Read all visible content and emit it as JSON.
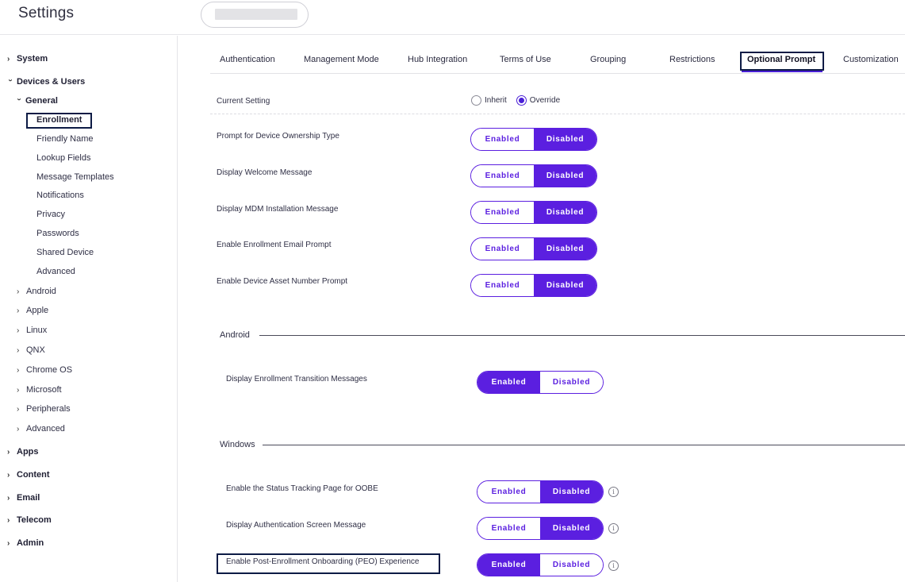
{
  "header": {
    "title": "Settings"
  },
  "sidebar": {
    "items": [
      {
        "label": "System"
      },
      {
        "label": "Devices & Users"
      },
      {
        "label": "General"
      },
      {
        "label": "Enrollment"
      },
      {
        "label": "Friendly Name"
      },
      {
        "label": "Lookup Fields"
      },
      {
        "label": "Message Templates"
      },
      {
        "label": "Notifications"
      },
      {
        "label": "Privacy"
      },
      {
        "label": "Passwords"
      },
      {
        "label": "Shared Device"
      },
      {
        "label": "Advanced"
      },
      {
        "label": "Android"
      },
      {
        "label": "Apple"
      },
      {
        "label": "Linux"
      },
      {
        "label": "QNX"
      },
      {
        "label": "Chrome OS"
      },
      {
        "label": "Microsoft"
      },
      {
        "label": "Peripherals"
      },
      {
        "label": "Advanced"
      },
      {
        "label": "Apps"
      },
      {
        "label": "Content"
      },
      {
        "label": "Email"
      },
      {
        "label": "Telecom"
      },
      {
        "label": "Admin"
      }
    ]
  },
  "tabs": [
    {
      "label": "Authentication"
    },
    {
      "label": "Management Mode"
    },
    {
      "label": "Hub Integration"
    },
    {
      "label": "Terms of Use"
    },
    {
      "label": "Grouping"
    },
    {
      "label": "Restrictions"
    },
    {
      "label": "Optional Prompt"
    },
    {
      "label": "Customization"
    }
  ],
  "active_tab": "Optional Prompt",
  "current_setting": {
    "label": "Current Setting",
    "options": [
      "Inherit",
      "Override"
    ],
    "selected": "Override"
  },
  "toggle_labels": {
    "enabled": "Enabled",
    "disabled": "Disabled"
  },
  "general_rows": [
    {
      "label": "Prompt for Device Ownership Type",
      "value": "Disabled"
    },
    {
      "label": "Display Welcome Message",
      "value": "Disabled"
    },
    {
      "label": "Display MDM Installation Message",
      "value": "Disabled"
    },
    {
      "label": "Enable Enrollment Email Prompt",
      "value": "Disabled"
    },
    {
      "label": "Enable Device Asset Number Prompt",
      "value": "Disabled"
    }
  ],
  "android": {
    "title": "Android",
    "rows": [
      {
        "label": "Display Enrollment Transition Messages",
        "value": "Enabled"
      }
    ]
  },
  "windows": {
    "title": "Windows",
    "rows": [
      {
        "label": "Enable the Status Tracking Page for OOBE",
        "value": "Disabled"
      },
      {
        "label": "Display Authentication Screen Message",
        "value": "Disabled"
      },
      {
        "label": "Enable Post-Enrollment Onboarding (PEO) Experience",
        "value": "Enabled"
      }
    ]
  },
  "icons": {
    "info": "info-icon",
    "chevron": "chevron-icon"
  },
  "colors": {
    "accent": "#5b1fe0",
    "highlight_box": "#0d1b45"
  }
}
